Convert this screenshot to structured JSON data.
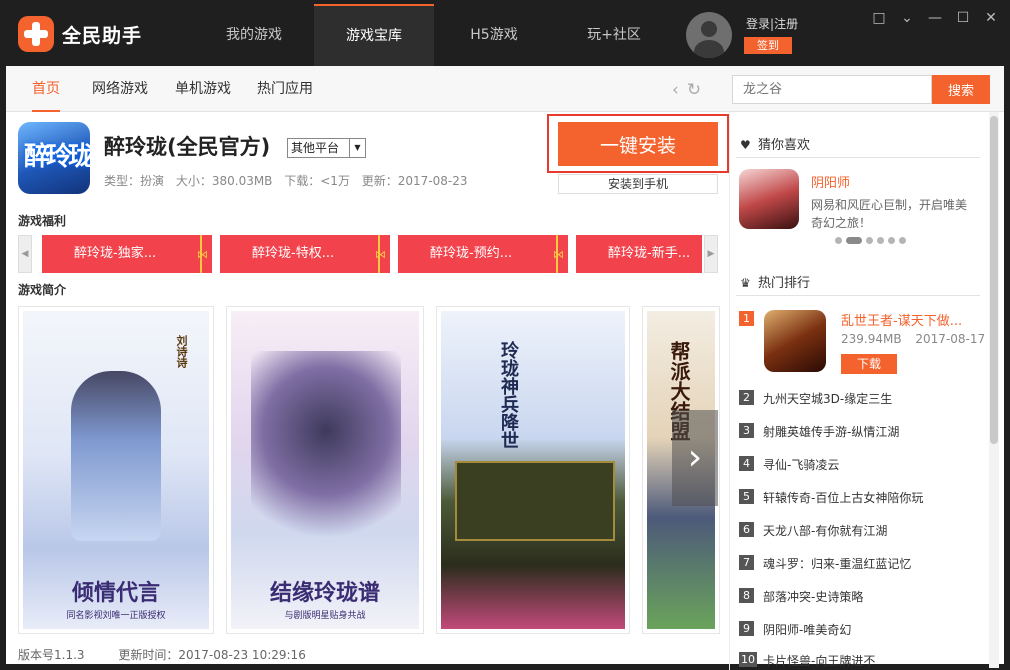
{
  "app": {
    "brand": "全民助手"
  },
  "topnav": [
    {
      "label": "我的游戏"
    },
    {
      "label": "游戏宝库"
    },
    {
      "label": "H5游戏"
    },
    {
      "label": "玩+社区"
    }
  ],
  "user": {
    "login": "登录",
    "sep": "|",
    "register": "注册",
    "signin": "签到"
  },
  "subnav": {
    "tabs": [
      {
        "label": "首页"
      },
      {
        "label": "网络游戏"
      },
      {
        "label": "单机游戏"
      },
      {
        "label": "热门应用"
      }
    ],
    "search_placeholder": "龙之谷",
    "search_button": "搜索"
  },
  "game": {
    "icon_text": "醉玲珑",
    "title": "醉玲珑(全民官方)",
    "platform": "其他平台",
    "type": "类型：扮演",
    "size": "大小：380.03MB",
    "downloads": "下载：<1万",
    "updated": "更新：2017-08-23",
    "install_label": "一键安装",
    "install_phone_label": "安装到手机"
  },
  "welfare": {
    "heading": "游戏福利",
    "items": [
      {
        "label": "醉玲珑-独家..."
      },
      {
        "label": "醉玲珑-特权..."
      },
      {
        "label": "醉玲珑-预约..."
      },
      {
        "label": "醉玲珑-新手..."
      }
    ]
  },
  "intro": {
    "heading": "游戏简介",
    "shots": [
      {
        "caption": "倾情代言",
        "sub": "同名影视刘唯一正版授权",
        "vert": "刘诗诗"
      },
      {
        "caption": "结缘玲珑谱",
        "sub": "与剧版明星贴身共战",
        "vert": ""
      },
      {
        "caption": "",
        "sub": "",
        "vert": "玲珑神兵降世"
      },
      {
        "caption": "",
        "sub": "",
        "vert": "帮派大结盟"
      }
    ]
  },
  "footer": {
    "version": "版本号1.1.3",
    "update_time": "更新时间：2017-08-23 10:29:16"
  },
  "recommend": {
    "heading": "猜你喜欢",
    "name": "阴阳师",
    "desc": "网易和风匠心巨制，开启唯美奇幻之旅！"
  },
  "ranking": {
    "heading": "热门排行",
    "top": {
      "num": "1",
      "name": "乱世王者-谋天下做...",
      "size": "239.94MB",
      "date": "2017-08-17",
      "download_label": "下载"
    },
    "items": [
      {
        "num": "2",
        "name": "九州天空城3D-缘定三生"
      },
      {
        "num": "3",
        "name": "射雕英雄传手游-纵情江湖"
      },
      {
        "num": "4",
        "name": "寻仙-飞骑凌云"
      },
      {
        "num": "5",
        "name": "轩辕传奇-百位上古女神陪你玩"
      },
      {
        "num": "6",
        "name": "天龙八部-有你就有江湖"
      },
      {
        "num": "7",
        "name": "魂斗罗：归来-重温红蓝记忆"
      },
      {
        "num": "8",
        "name": "部落冲突-史诗策略"
      },
      {
        "num": "9",
        "name": "阴阳师-唯美奇幻"
      },
      {
        "num": "10",
        "name": "卡片怪兽-向王牌进不"
      }
    ]
  },
  "colors": {
    "accent": "#f4622d",
    "welfare": "#f2434d",
    "titlebar": "#1f1f1f"
  }
}
